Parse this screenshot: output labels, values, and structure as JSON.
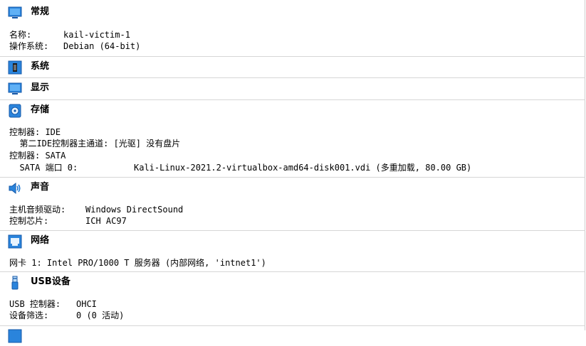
{
  "sections": {
    "general": {
      "title": "常规",
      "name_label": "名称:",
      "name_value": "kail-victim-1",
      "os_label": "操作系统:",
      "os_value": "Debian (64-bit)"
    },
    "system": {
      "title": "系统"
    },
    "display": {
      "title": "显示"
    },
    "storage": {
      "title": "存储",
      "ctrl_ide": "控制器: IDE",
      "ide_secondary_master": "  第二IDE控制器主通道: [光驱] 没有盘片",
      "ctrl_sata": "控制器: SATA",
      "sata_port_label": "  SATA 端口 0:",
      "sata_port_value": "Kali-Linux-2021.2-virtualbox-amd64-disk001.vdi (多重加载, 80.00 GB)"
    },
    "audio": {
      "title": "声音",
      "driver_label": "主机音频驱动:",
      "driver_value": "Windows DirectSound",
      "chip_label": "控制芯片:",
      "chip_value": "ICH AC97"
    },
    "network": {
      "title": "网络",
      "adapter1": "网卡 1: Intel PRO/1000 T 服务器 (内部网络, 'intnet1')"
    },
    "usb": {
      "title": "USB设备",
      "ctrl_label": "USB 控制器:",
      "ctrl_value": "OHCI",
      "filter_label": "设备筛选:",
      "filter_value": "0 (0 活动)"
    }
  },
  "icons": {
    "general": "monitor-icon",
    "system": "chip-icon",
    "display": "monitor-icon",
    "storage": "disk-icon",
    "audio": "speaker-icon",
    "network": "network-icon",
    "usb": "usb-icon"
  },
  "colors": {
    "icon_blue": "#1e7bd8",
    "divider": "#d6d6d6"
  }
}
